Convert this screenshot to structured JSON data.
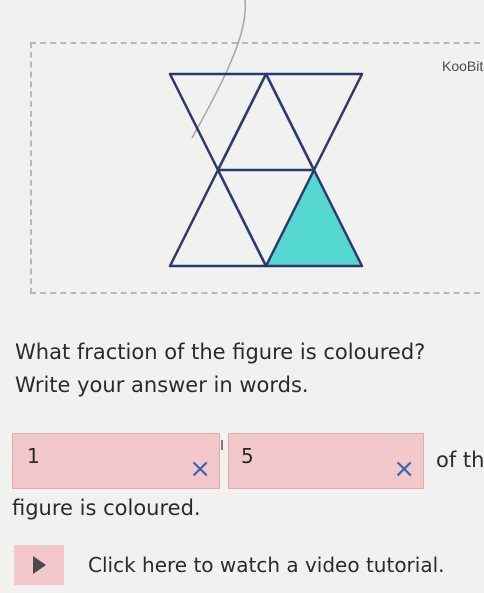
{
  "brand": {
    "name": "KooBit"
  },
  "figure": {
    "shaded_color": "#56d8d2",
    "line_color": "#2a3a6a",
    "triangle_total": 5,
    "triangle_shaded": 1
  },
  "question": {
    "line1": "What fraction of the figure is coloured?",
    "line2": "Write your answer in words."
  },
  "answer": {
    "numerator_value": "1",
    "denominator_value": "5",
    "clear_glyph": "×",
    "suffix_text": "of th",
    "continuation_text": "figure is coloured."
  },
  "video": {
    "link_text": "Click here to watch a video tutorial.",
    "button_color": "#f3c8cb"
  }
}
